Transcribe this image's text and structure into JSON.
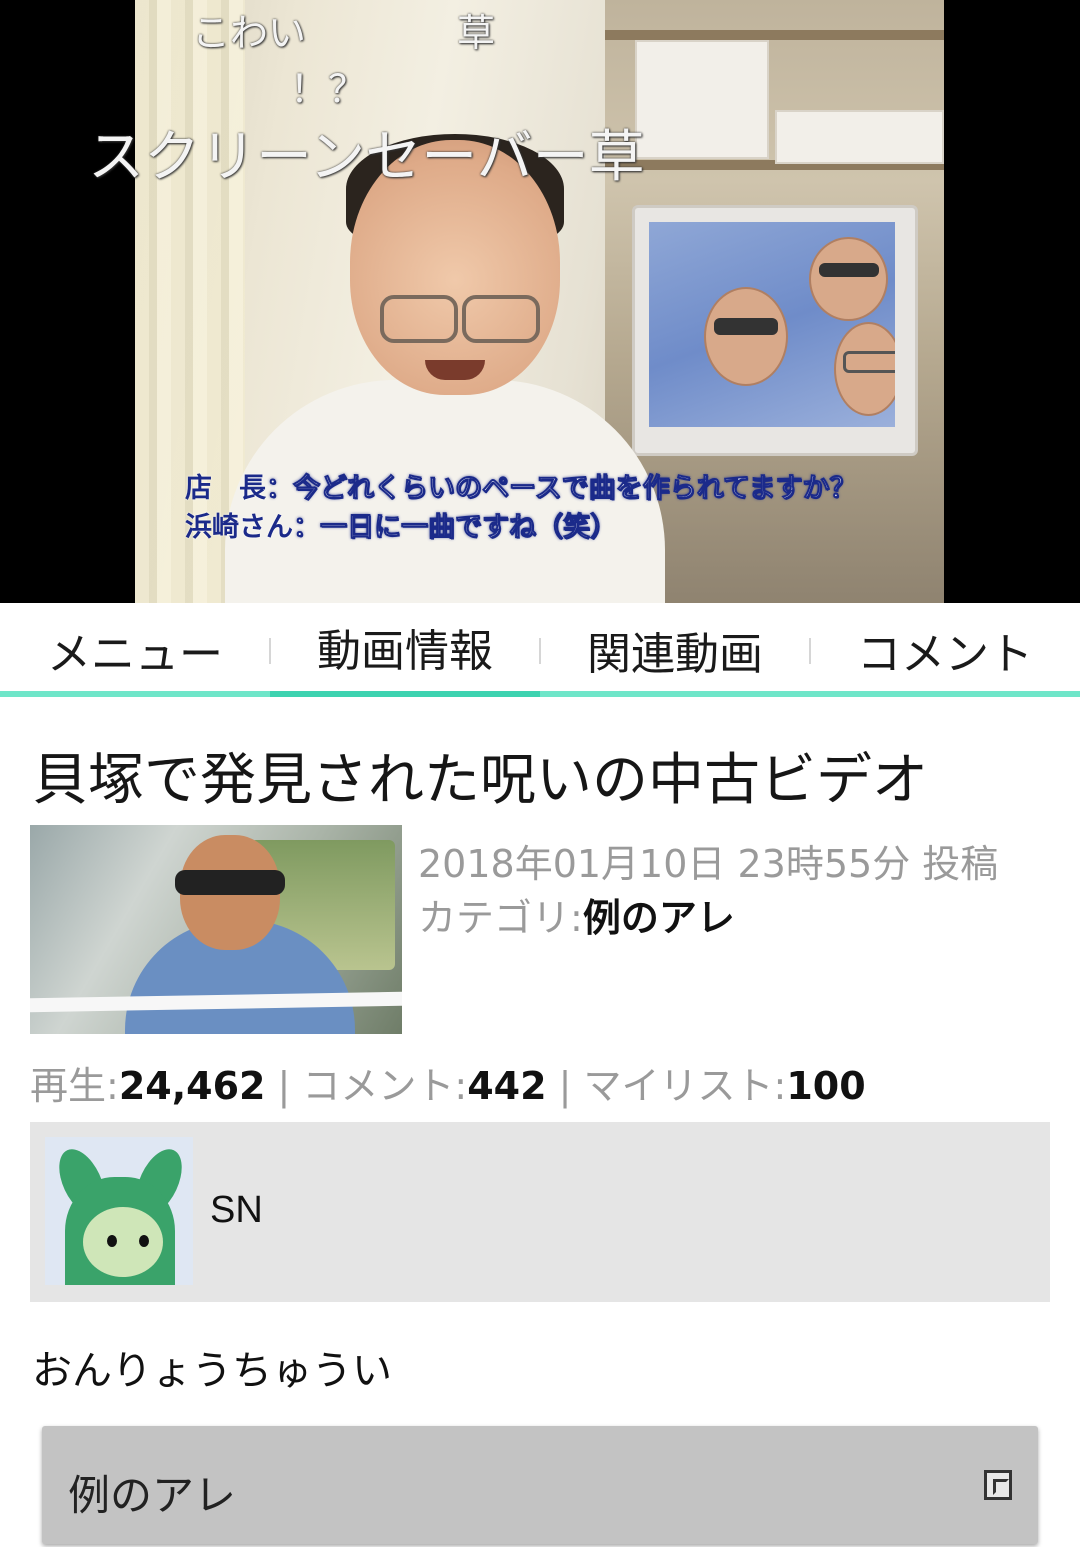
{
  "player": {
    "danmaku": [
      "こわい",
      "草",
      "！？",
      "スクリーンセーバー草"
    ],
    "subtitles": [
      {
        "speaker": "店　長",
        "text": "：今どれくらいのペースで曲を作られてますか？"
      },
      {
        "speaker": "浜崎さん",
        "text": "：一日に一曲ですね（笑）"
      }
    ]
  },
  "tabs": {
    "items": [
      "メニュー",
      "動画情報",
      "関連動画",
      "コメント"
    ],
    "active_index": 1
  },
  "video": {
    "title": "貝塚で発見された呪いの中古ビデオ",
    "posted": "2018年01月10日 23時55分 投稿",
    "category_label": "カテゴリ:",
    "category_value": "例のアレ",
    "stats": {
      "views_label": "再生:",
      "views": "24,462",
      "comments_label": "コメント:",
      "comments": "442",
      "mylist_label": "マイリスト:",
      "mylist": "100",
      "separator": " | "
    },
    "uploader": "SN",
    "description": "おんりょうちゅうい",
    "tag": "例のアレ"
  },
  "colors": {
    "tab_accent": "#3dd3b0",
    "tab_border": "#6fe6c9",
    "uploader_bg": "#e5e5e5",
    "tag_bg": "#c3c3c3",
    "meta_gray": "#9a9a9a"
  }
}
